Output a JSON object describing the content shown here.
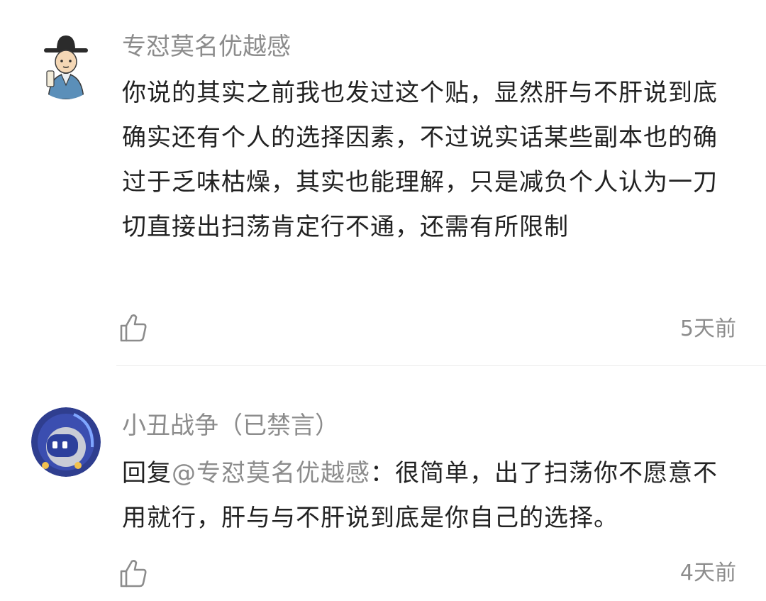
{
  "comments": [
    {
      "username": "专怼莫名优越感",
      "text": "你说的其实之前我也发过这个贴，显然肝与不肝说到底确实还有个人的选择因素，不过说实话某些副本也的确过于乏味枯燥，其实也能理解，只是减负个人认为一刀切直接出扫荡肯定行不通，还需有所限制",
      "time": "5天前",
      "like_icon": "thumbs-up-icon",
      "avatar_icon": "scholar-avatar"
    },
    {
      "username": "小丑战争（已禁言）",
      "reply_prefix": "回复",
      "mention": "@专怼莫名优越感",
      "text": "：很简单，出了扫荡你不愿意不用就行，肝与与不肝说到底是你自己的选择。",
      "time": "4天前",
      "like_icon": "thumbs-up-icon",
      "avatar_icon": "robot-avatar"
    }
  ],
  "colors": {
    "text": "#222222",
    "muted": "#8c8c8c",
    "divider": "#ececec"
  }
}
